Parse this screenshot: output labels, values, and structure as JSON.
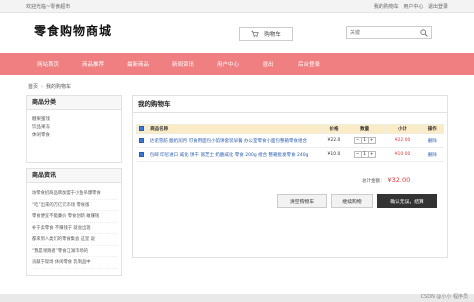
{
  "topbar": {
    "welcome": "欢迎光临~零食超市",
    "links": [
      "我的购物车",
      "用户中心",
      "退出登录"
    ]
  },
  "header": {
    "logo": "零食购物商城",
    "cart_label": "购物车",
    "search_placeholder": "关键"
  },
  "nav": {
    "items": [
      "网站首页",
      "商品推荐",
      "最新商品",
      "新闻资讯",
      "用户中心",
      "退出",
      "后台登录"
    ]
  },
  "breadcrumb": {
    "home": "首页",
    "current": "我的购物车"
  },
  "sidebar": {
    "category_title": "商品分类",
    "categories": [
      "糖果蜜饯",
      "饮品果冻",
      "休闲零食"
    ],
    "news_title": "商品资讯",
    "news": [
      "坊零食招商品牌加盟于小鱼吊爆零食",
      "“吃”出来的万亿元市场 零食版",
      "零食便宜不能廉价 零食创新 敢赚钱",
      "补于卖零食 不赚钱于 就会出现",
      "都来到人类们的零食集会 这里 说",
      "“我是领跑者”零食江湖市场的",
      "贡献于现场 休闲零食 乳制品中"
    ]
  },
  "cart": {
    "title": "我的购物车",
    "headers": {
      "name": "商品名称",
      "price": "价格",
      "qty": "数量",
      "subtotal": "小计",
      "op": "操作"
    },
    "rows": [
      {
        "name": "达诺雪舫 酸奶润月 可食用面包小馅饼套装早餐 办公室零食小面包整箱零食组合",
        "price": "¥22.0",
        "qty": "1",
        "subtotal": "¥22.00",
        "op": "删除"
      },
      {
        "name": "包邮 印尼进口 威化 饼干 丽芝士 奶酪威化 零食 200g 组合 整箱批发零食 240g",
        "price": "¥10.0",
        "qty": "1",
        "subtotal": "¥10.00",
        "op": "删除"
      }
    ],
    "total_label": "总计金额：",
    "total_value": "¥32.00",
    "buttons": {
      "clear": "清空购物车",
      "continue": "继续购物",
      "checkout": "确认无误，结算"
    }
  },
  "watermark": "CSDN @小小 程序员"
}
